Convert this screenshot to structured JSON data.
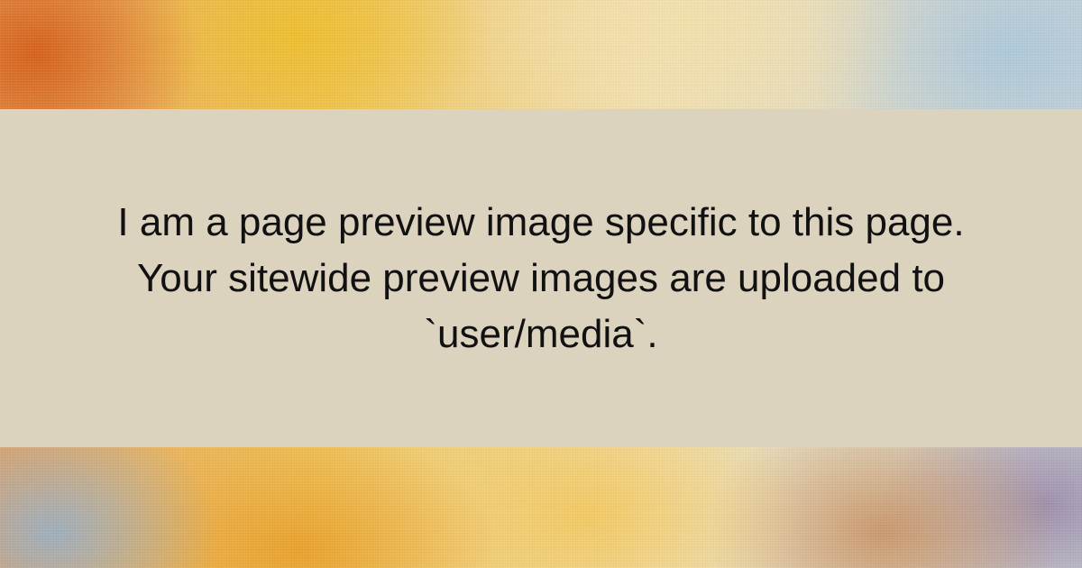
{
  "preview": {
    "lines": [
      "I am a page preview image specific to this page.",
      "Your sitewide preview images are uploaded to",
      "`user/media`."
    ]
  },
  "colors": {
    "banner_background": "#dcd3bf",
    "text": "#111111"
  }
}
